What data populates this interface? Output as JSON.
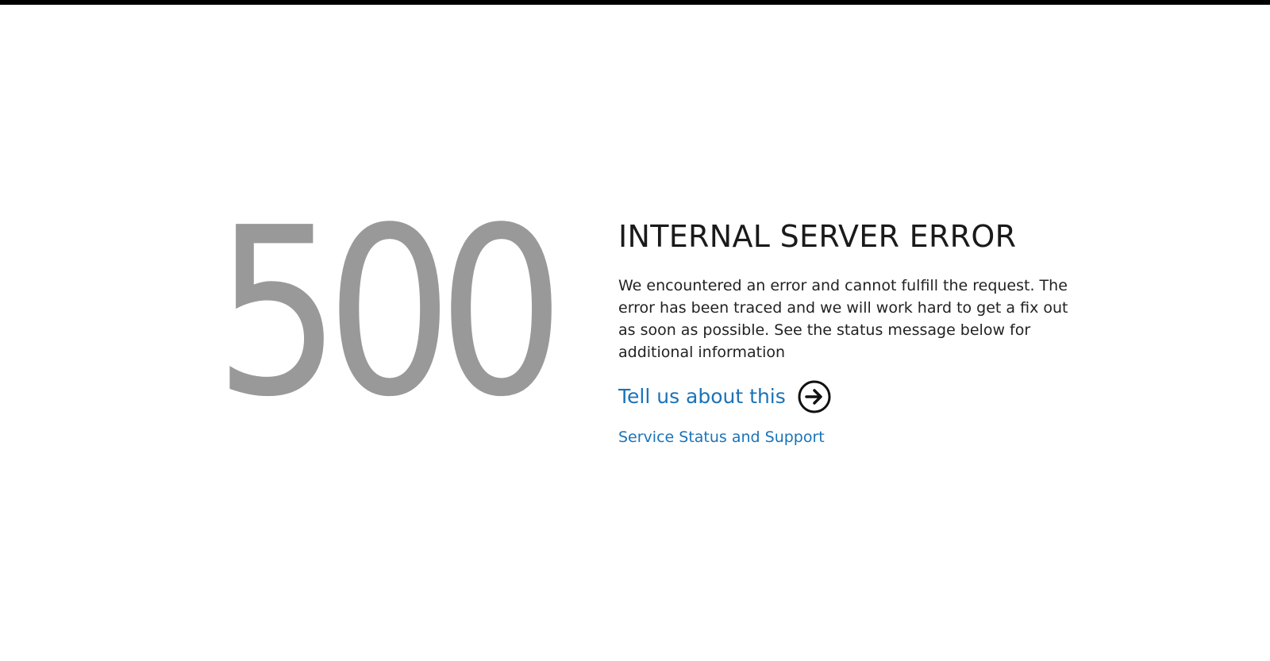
{
  "error": {
    "code": "500",
    "title": "INTERNAL SERVER ERROR",
    "message": "We encountered an error and cannot fulfill the request. The error has been traced and we will work hard to get a fix out as soon as possible. See the status message below for additional information"
  },
  "links": {
    "tell_us": "Tell us about this",
    "tell_us_icon": "arrow-right-circle-icon",
    "status_support": "Service Status and Support"
  },
  "colors": {
    "code": "#999999",
    "link": "#1a73b8",
    "title": "#1a1a1a",
    "top_bar": "#000000"
  }
}
